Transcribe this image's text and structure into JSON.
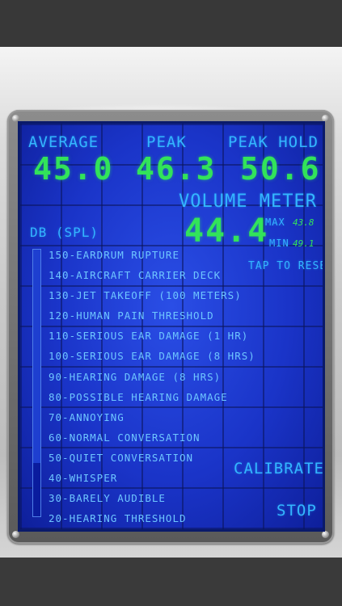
{
  "readouts": {
    "average": {
      "label": "AVERAGE",
      "value": "45.0"
    },
    "peak": {
      "label": "PEAK",
      "value": "46.3"
    },
    "peak_hold": {
      "label": "PEAK HOLD",
      "value": "50.6"
    }
  },
  "volume_meter": {
    "title": "VOLUME METER",
    "value": "44.4",
    "max_label": "MAX",
    "max_value": "43.8",
    "min_label": "MIN",
    "min_value": "49.1",
    "reset_label": "TAP TO RESET"
  },
  "scale": {
    "title": "DB (SPL)",
    "items": [
      "150-EARDRUM RUPTURE",
      "140-AIRCRAFT CARRIER DECK",
      "130-JET TAKEOFF (100 METERS)",
      "120-HUMAN PAIN THRESHOLD",
      "110-SERIOUS EAR DAMAGE (1 HR)",
      "100-SERIOUS EAR DAMAGE (8 HRS)",
      "90-HEARING DAMAGE (8 HRS)",
      "80-POSSIBLE HEARING DAMAGE",
      "70-ANNOYING",
      "60-NORMAL CONVERSATION",
      "50-QUIET CONVERSATION",
      "40-WHISPER",
      "30-BARELY AUDIBLE",
      "20-HEARING THRESHOLD"
    ],
    "level_fraction": 0.2
  },
  "controls": {
    "calibrate_label": "CALIBRATE",
    "stop_label": "STOP"
  },
  "colors": {
    "screen_blue": "#1a34c8",
    "label_cyan": "#33b6ff",
    "digit_green": "#32e35a"
  }
}
